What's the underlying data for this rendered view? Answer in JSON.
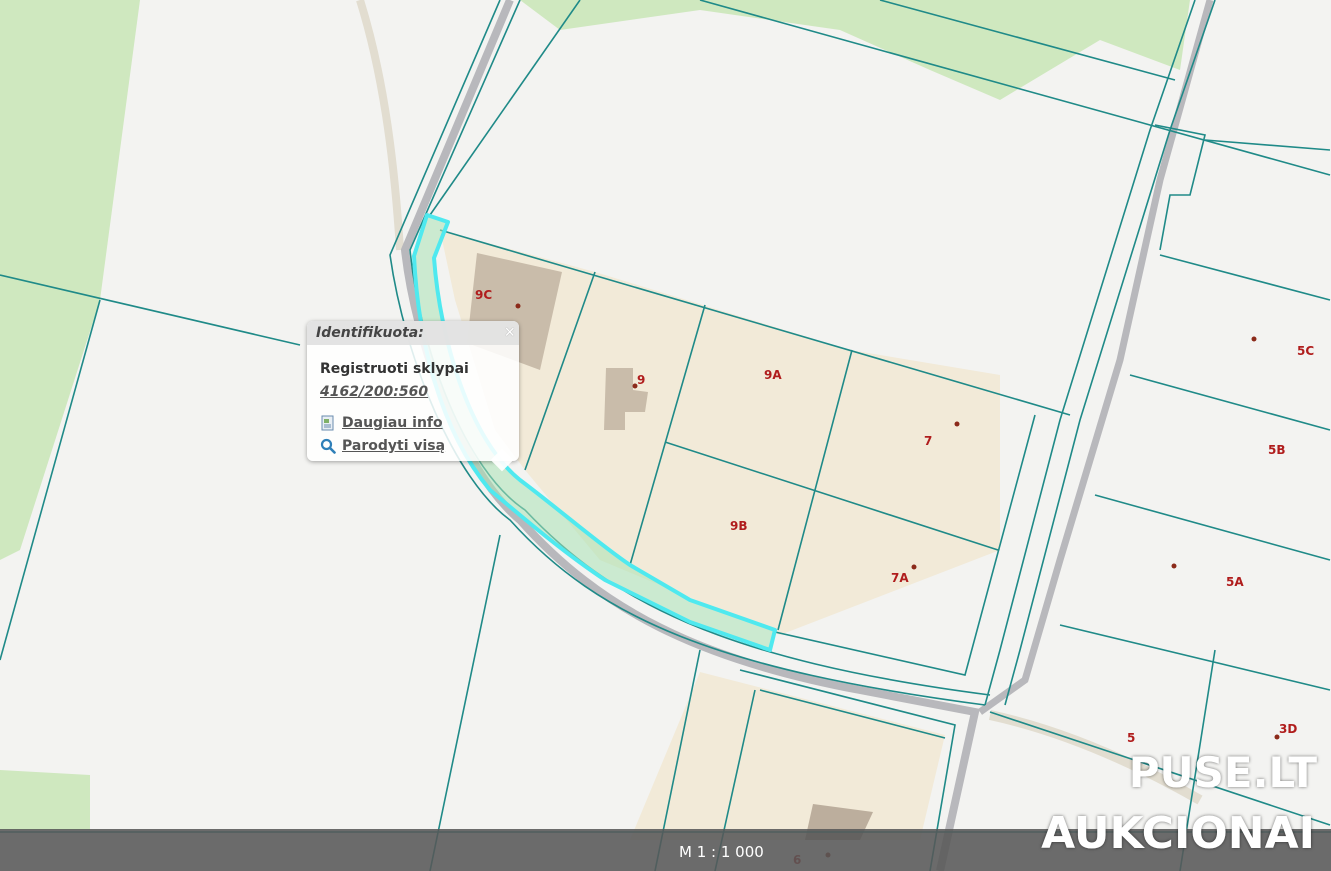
{
  "popup": {
    "title": "Identifikuota:",
    "close": "×",
    "layer": "Registruoti sklypai",
    "parcel_id": "4162/200:560",
    "more_info": "Daugiau info",
    "show_all": "Parodyti visą"
  },
  "parcel_labels": [
    "9C",
    "9",
    "9A",
    "7",
    "9B",
    "7A",
    "5C",
    "5B",
    "5A",
    "5",
    "3D",
    "6"
  ],
  "scale": {
    "label": "M 1 : 1 000"
  },
  "watermark": {
    "line1": "PUSE.LT",
    "line2": "AUKCIONAI"
  },
  "colors": {
    "boundary": "#1f8a88",
    "highlight": "#4fe9ef",
    "road": "#b8b8bc",
    "building": "#cbbfae",
    "parcel_fill": "#f2ead8",
    "green": "#cfe8bf",
    "label": "#b01d1d"
  },
  "icons": {
    "more_info": "document-icon",
    "show_all": "magnifier-icon",
    "close": "close-icon"
  }
}
